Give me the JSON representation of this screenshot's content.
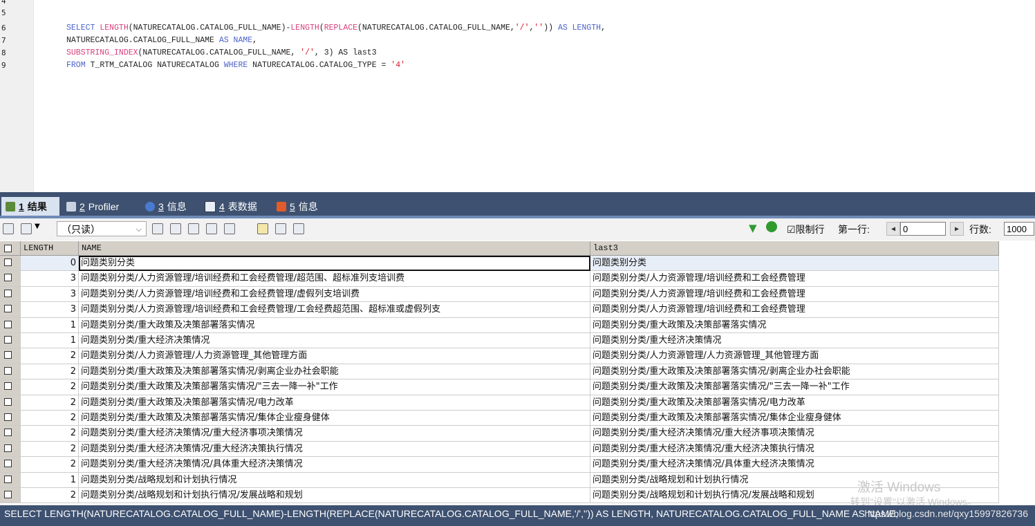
{
  "editor": {
    "line_numbers": [
      "4",
      "5",
      "6",
      "7",
      "8",
      "9"
    ],
    "code": {
      "line6": {
        "kw1": "SELECT",
        "fn1": "LENGTH",
        "a": "(NATURECATALOG.CATALOG_FULL_NAME)-",
        "fn2": "LENGTH",
        "b": "(",
        "fn3": "REPLACE",
        "c": "(NATURECATALOG.CATALOG_FULL_NAME,",
        "s1": "'/'",
        "d": ",",
        "s2": "''",
        "e": ")) ",
        "kw2": "AS LENGTH",
        "f": ","
      },
      "line7": {
        "a": "NATURECATALOG.CATALOG_FULL_NAME ",
        "kw": "AS NAME",
        "b": ","
      },
      "line8": {
        "fn": "SUBSTRING_INDEX",
        "a": "(NATURECATALOG.CATALOG_FULL_NAME, ",
        "s": "'/'",
        "b": ", 3) AS last3"
      },
      "line9": {
        "kw1": "FROM",
        "a": " T_RTM_CATALOG NATURECATALOG ",
        "kw2": "WHERE",
        "b": " NATURECATALOG.CATALOG_TYPE = ",
        "s": "'4'"
      }
    }
  },
  "tabs": [
    {
      "num": "1",
      "label": "结果",
      "active": true,
      "icon": "grid-icon"
    },
    {
      "num": "2",
      "label": "Profiler",
      "active": false,
      "icon": "profiler-icon"
    },
    {
      "num": "3",
      "label": "信息",
      "active": false,
      "icon": "info-icon"
    },
    {
      "num": "4",
      "label": "表数据",
      "active": false,
      "icon": "table-icon"
    },
    {
      "num": "5",
      "label": "信息",
      "active": false,
      "icon": "chart-icon"
    }
  ],
  "toolbar": {
    "mode": "（只读）",
    "limit_label": "☑限制行",
    "first_row_label": "第一行:",
    "first_row_value": "0",
    "rows_label": "行数:",
    "rows_value": "1000"
  },
  "grid": {
    "columns": [
      "LENGTH",
      "NAME",
      "last3"
    ],
    "rows": [
      [
        "0",
        "问题类别分类",
        "问题类别分类"
      ],
      [
        "3",
        "问题类别分类/人力资源管理/培训经费和工会经费管理/超范围、超标准列支培训费",
        "问题类别分类/人力资源管理/培训经费和工会经费管理"
      ],
      [
        "3",
        "问题类别分类/人力资源管理/培训经费和工会经费管理/虚假列支培训费",
        "问题类别分类/人力资源管理/培训经费和工会经费管理"
      ],
      [
        "3",
        "问题类别分类/人力资源管理/培训经费和工会经费管理/工会经费超范围、超标准或虚假列支",
        "问题类别分类/人力资源管理/培训经费和工会经费管理"
      ],
      [
        "1",
        "问题类别分类/重大政策及决策部署落实情况",
        "问题类别分类/重大政策及决策部署落实情况"
      ],
      [
        "1",
        "问题类别分类/重大经济决策情况",
        "问题类别分类/重大经济决策情况"
      ],
      [
        "2",
        "问题类别分类/人力资源管理/人力资源管理_其他管理方面",
        "问题类别分类/人力资源管理/人力资源管理_其他管理方面"
      ],
      [
        "2",
        "问题类别分类/重大政策及决策部署落实情况/剥离企业办社会职能",
        "问题类别分类/重大政策及决策部署落实情况/剥离企业办社会职能"
      ],
      [
        "2",
        "问题类别分类/重大政策及决策部署落实情况/\"三去一降一补\"工作",
        "问题类别分类/重大政策及决策部署落实情况/\"三去一降一补\"工作"
      ],
      [
        "2",
        "问题类别分类/重大政策及决策部署落实情况/电力改革",
        "问题类别分类/重大政策及决策部署落实情况/电力改革"
      ],
      [
        "2",
        "问题类别分类/重大政策及决策部署落实情况/集体企业瘦身健体",
        "问题类别分类/重大政策及决策部署落实情况/集体企业瘦身健体"
      ],
      [
        "2",
        "问题类别分类/重大经济决策情况/重大经济事项决策情况",
        "问题类别分类/重大经济决策情况/重大经济事项决策情况"
      ],
      [
        "2",
        "问题类别分类/重大经济决策情况/重大经济决策执行情况",
        "问题类别分类/重大经济决策情况/重大经济决策执行情况"
      ],
      [
        "2",
        "问题类别分类/重大经济决策情况/具体重大经济决策情况",
        "问题类别分类/重大经济决策情况/具体重大经济决策情况"
      ],
      [
        "1",
        "问题类别分类/战略规划和计划执行情况",
        "问题类别分类/战略规划和计划执行情况"
      ],
      [
        "2",
        "问题类别分类/战略规划和计划执行情况/发展战略和规划",
        "问题类别分类/战略规划和计划执行情况/发展战略和规划"
      ]
    ]
  },
  "watermark": {
    "line1": "激活 Windows",
    "line2": "转到\"设置\"以激活 Windows。"
  },
  "status": {
    "sql": "SELECT LENGTH(NATURECATALOG.CATALOG_FULL_NAME)-LENGTH(REPLACE(NATURECATALOG.CATALOG_FULL_NAME,'/','')) AS LENGTH, NATURECATALOG.CATALOG_FULL_NAME AS NAME,",
    "url": "https://blog.csdn.net/qxy15997826736"
  },
  "colors": {
    "tabbar": "#3e5170",
    "keyword": "#4a62c8",
    "function": "#d8407c",
    "string": "#d81a2c"
  }
}
